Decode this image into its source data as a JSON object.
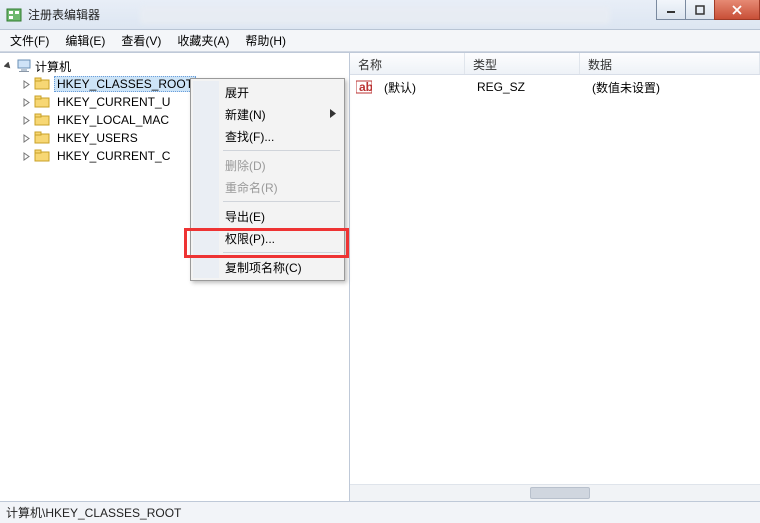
{
  "window": {
    "title": "注册表编辑器"
  },
  "menubar": {
    "items": [
      {
        "label": "文件(F)"
      },
      {
        "label": "编辑(E)"
      },
      {
        "label": "查看(V)"
      },
      {
        "label": "收藏夹(A)"
      },
      {
        "label": "帮助(H)"
      }
    ]
  },
  "tree": {
    "root_label": "计算机",
    "items": [
      {
        "label": "HKEY_CLASSES_ROOT",
        "selected": true
      },
      {
        "label": "HKEY_CURRENT_U"
      },
      {
        "label": "HKEY_LOCAL_MAC"
      },
      {
        "label": "HKEY_USERS"
      },
      {
        "label": "HKEY_CURRENT_C"
      }
    ]
  },
  "list": {
    "headers": {
      "name": "名称",
      "type": "类型",
      "data": "数据"
    },
    "rows": [
      {
        "name": "(默认)",
        "type": "REG_SZ",
        "data": "(数值未设置)"
      }
    ]
  },
  "context_menu": {
    "items": [
      {
        "label": "展开",
        "kind": "item"
      },
      {
        "label": "新建(N)",
        "kind": "submenu"
      },
      {
        "label": "查找(F)...",
        "kind": "item"
      },
      {
        "kind": "sep"
      },
      {
        "label": "删除(D)",
        "kind": "item",
        "disabled": true
      },
      {
        "label": "重命名(R)",
        "kind": "item",
        "disabled": true
      },
      {
        "kind": "sep"
      },
      {
        "label": "导出(E)",
        "kind": "item"
      },
      {
        "label": "权限(P)...",
        "kind": "item",
        "highlighted": true
      },
      {
        "kind": "sep"
      },
      {
        "label": "复制项名称(C)",
        "kind": "item"
      }
    ]
  },
  "statusbar": {
    "path": "计算机\\HKEY_CLASSES_ROOT"
  }
}
